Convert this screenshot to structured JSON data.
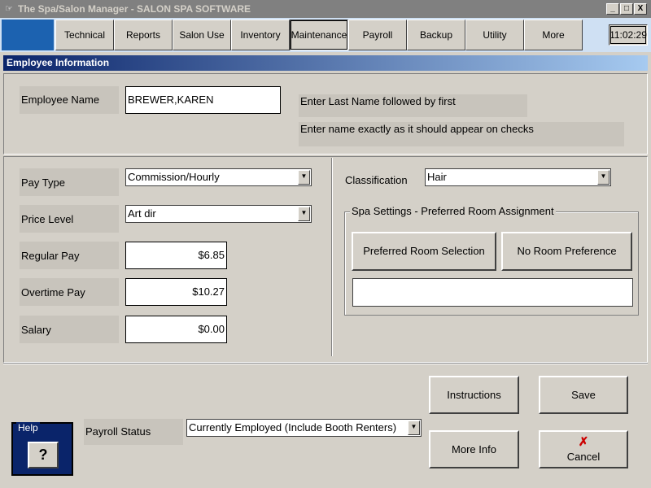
{
  "window": {
    "title": "The Spa/Salon Manager - SALON SPA SOFTWARE",
    "app_icon": "☞",
    "minimize": "_",
    "maximize": "□",
    "close": "X"
  },
  "toolbar": {
    "items": [
      {
        "label": "Technical"
      },
      {
        "label": "Reports"
      },
      {
        "label": "Salon Use"
      },
      {
        "label": "Inventory"
      },
      {
        "label": "Maintenance"
      },
      {
        "label": "Payroll"
      },
      {
        "label": "Backup"
      },
      {
        "label": "Utility"
      },
      {
        "label": "More"
      }
    ],
    "clock": "11:02:29"
  },
  "section_title": "Employee Information",
  "employee": {
    "name_label": "Employee Name",
    "name_value": "BREWER,KAREN",
    "hint1": "Enter Last Name followed by first",
    "hint2": "Enter name exactly as it should appear on checks"
  },
  "pay": {
    "pay_type_label": "Pay Type",
    "pay_type_value": "Commission/Hourly",
    "price_level_label": "Price Level",
    "price_level_value": "Art dir",
    "regular_pay_label": "Regular Pay",
    "regular_pay_value": "$6.85",
    "overtime_pay_label": "Overtime Pay",
    "overtime_pay_value": "$10.27",
    "salary_label": "Salary",
    "salary_value": "$0.00"
  },
  "classification": {
    "label": "Classification",
    "value": "Hair"
  },
  "spa": {
    "group_title": "Spa Settings - Preferred Room Assignment",
    "preferred_room_button": "Preferred Room Selection",
    "no_room_button": "No Room Preference",
    "room_value": ""
  },
  "bottom": {
    "help_title": "Help",
    "help_icon_text": "?",
    "payroll_status_label": "Payroll Status",
    "payroll_status_value": "Currently Employed (Include Booth Renters)",
    "instructions_button": "Instructions",
    "save_button": "Save",
    "more_info_button": "More Info",
    "cancel_button": "Cancel",
    "cancel_icon": "✗"
  },
  "colors": {
    "window_bg": "#d4d0c8",
    "toolbar_bg": "#cfe0f3",
    "accent": "#1c62b0",
    "header_start": "#0a246a",
    "header_end": "#a6caf0",
    "cancel_icon": "#cc0000"
  }
}
